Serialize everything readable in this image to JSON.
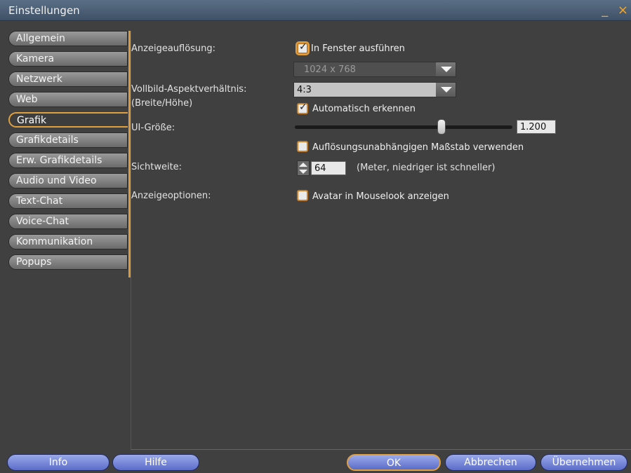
{
  "window": {
    "title": "Einstellungen",
    "controls": "_ ×"
  },
  "sidebar": {
    "items": [
      {
        "label": "Allgemein"
      },
      {
        "label": "Kamera"
      },
      {
        "label": "Netzwerk"
      },
      {
        "label": "Web"
      },
      {
        "label": "Grafik"
      },
      {
        "label": "Grafikdetails"
      },
      {
        "label": "Erw. Grafikdetails"
      },
      {
        "label": "Audio und Video"
      },
      {
        "label": "Text-Chat"
      },
      {
        "label": "Voice-Chat"
      },
      {
        "label": "Kommunikation"
      },
      {
        "label": "Popups"
      }
    ],
    "active_index": 4
  },
  "panel": {
    "resolution_label": "Anzeigeauflösung:",
    "windowed_checkbox": {
      "label": "In Fenster ausführen",
      "checked": true
    },
    "resolution_select": {
      "value": "1024 x 768",
      "disabled": true
    },
    "aspect_label": "Vollbild-Aspektverhältnis:",
    "aspect_sublabel": "(Breite/Höhe)",
    "aspect_select": {
      "value": "4:3"
    },
    "auto_detect_checkbox": {
      "label": "Automatisch erkennen",
      "checked": true
    },
    "ui_size_label": "UI-Größe:",
    "ui_size_value": "1.200",
    "resolution_independent_checkbox": {
      "label": "Auflösungsunabhängigen Maßstab verwenden",
      "checked": false
    },
    "draw_distance_label": "Sichtweite:",
    "draw_distance_value": "64",
    "draw_distance_hint": "(Meter, niedriger ist schneller)",
    "display_options_label": "Anzeigeoptionen:",
    "mouselook_checkbox": {
      "label": "Avatar in Mouselook anzeigen",
      "checked": false
    }
  },
  "footer": {
    "info_label": "Info",
    "help_label": "Hilfe",
    "ok_label": "OK",
    "cancel_label": "Abbrechen",
    "apply_label": "Übernehmen"
  }
}
